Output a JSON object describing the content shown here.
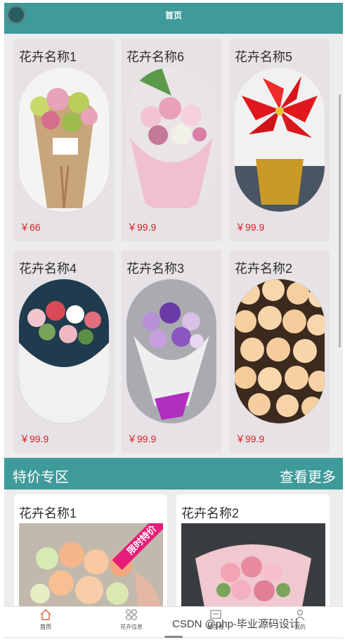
{
  "header": {
    "title": "首页"
  },
  "products": [
    {
      "name": "花卉名称1",
      "price": "￥66"
    },
    {
      "name": "花卉名称6",
      "price": "￥99.9"
    },
    {
      "name": "花卉名称5",
      "price": "￥99.9"
    },
    {
      "name": "花卉名称4",
      "price": "￥99.9"
    },
    {
      "name": "花卉名称3",
      "price": "￥99.9"
    },
    {
      "name": "花卉名称2",
      "price": "￥99.9"
    }
  ],
  "special": {
    "title": "特价专区",
    "more": "查看更多",
    "items": [
      {
        "name": "花卉名称1",
        "badge": "限时特价"
      },
      {
        "name": "花卉名称2"
      }
    ]
  },
  "nav": [
    {
      "label": "首页",
      "icon": "home-icon"
    },
    {
      "label": "花卉信息",
      "icon": "grid-icon"
    },
    {
      "label": "留言板",
      "icon": "message-icon"
    },
    {
      "label": "我的",
      "icon": "user-icon"
    }
  ],
  "watermark": "CSDN @php-毕业源码设计",
  "colors": {
    "primary": "#3f9a9a",
    "price": "#d81e1e",
    "badge": "#e51d78",
    "card": "#e6e2e6"
  }
}
